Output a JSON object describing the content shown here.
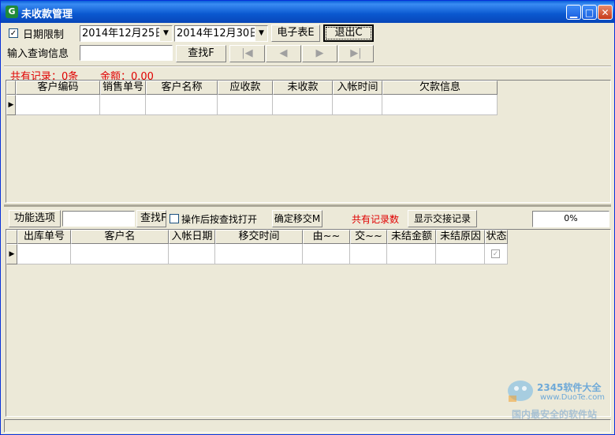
{
  "window": {
    "title": "未收款管理"
  },
  "toolbar": {
    "date_limit_label": "日期限制",
    "date_limit_checked": true,
    "date_from": "2014年12月25日",
    "date_to": "2014年12月30日",
    "excel_label": "电子表E",
    "exit_label": "退出C",
    "query_label": "输入查询信息",
    "query_value": "",
    "find_label": "查找F",
    "nav": [
      "|◀",
      "◀",
      "▶",
      "▶|"
    ]
  },
  "summary": {
    "records": "共有记录：0条",
    "amount": "金额：0.00"
  },
  "grid1": {
    "columns": [
      "客户编码",
      "销售单号",
      "客户名称",
      "应收款",
      "未收款",
      "入帐时间",
      "欠款信息"
    ]
  },
  "bottom_toolbar": {
    "func_label": "功能选项",
    "search_value": "",
    "find_label": "查找F",
    "open_after_label": "操作后按查找打开",
    "confirm_label": "确定移交M",
    "records_label": "共有记录数",
    "show_handover_label": "显示交接记录",
    "progress_text": "0%"
  },
  "grid2": {
    "columns": [
      "出库单号",
      "客户名",
      "入帐日期",
      "移交时间",
      "由~~",
      "交~~",
      "未结金额",
      "未结原因",
      "状态"
    ],
    "status_checked": true
  },
  "watermark": {
    "logo_text": "2345软件大全",
    "url": "www.DuoTe.com",
    "slogan": "国内最安全的软件站"
  }
}
